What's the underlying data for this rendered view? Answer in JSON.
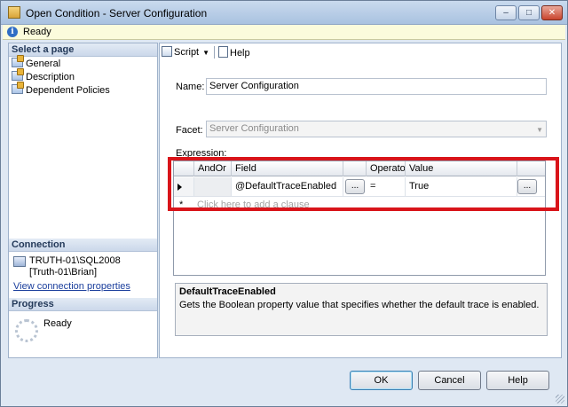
{
  "window": {
    "title": "Open Condition - Server Configuration",
    "controls": {
      "minimize": "–",
      "maximize": "□",
      "close": "✕"
    }
  },
  "status": {
    "text": "Ready"
  },
  "left": {
    "select_page_header": "Select a page",
    "pages": [
      {
        "label": "General"
      },
      {
        "label": "Description"
      },
      {
        "label": "Dependent Policies"
      }
    ],
    "connection_header": "Connection",
    "server": "TRUTH-01\\SQL2008",
    "user": "[Truth-01\\Brian]",
    "view_connection_link": "View connection properties",
    "progress_header": "Progress",
    "progress_status": "Ready"
  },
  "toolbar": {
    "script_label": "Script",
    "help_label": "Help"
  },
  "form": {
    "name_label": "Name:",
    "name_value": "Server Configuration",
    "facet_label": "Facet:",
    "facet_value": "Server Configuration",
    "expression_label": "Expression:"
  },
  "grid": {
    "columns": [
      "AndOr",
      "Field",
      "Operato",
      "Value"
    ],
    "rows": [
      {
        "andor": "",
        "field": "@DefaultTraceEnabled",
        "operator": "=",
        "value": "True"
      }
    ],
    "ellipsis": "...",
    "new_row_marker": "*",
    "new_row_hint": "Click here to add a clause"
  },
  "description": {
    "title": "DefaultTraceEnabled",
    "text": "Gets the Boolean property value that specifies whether the default trace is enabled."
  },
  "buttons": {
    "ok": "OK",
    "cancel": "Cancel",
    "help": "Help"
  },
  "colors": {
    "highlight": "#d9141a",
    "link": "#1a3e9c"
  }
}
